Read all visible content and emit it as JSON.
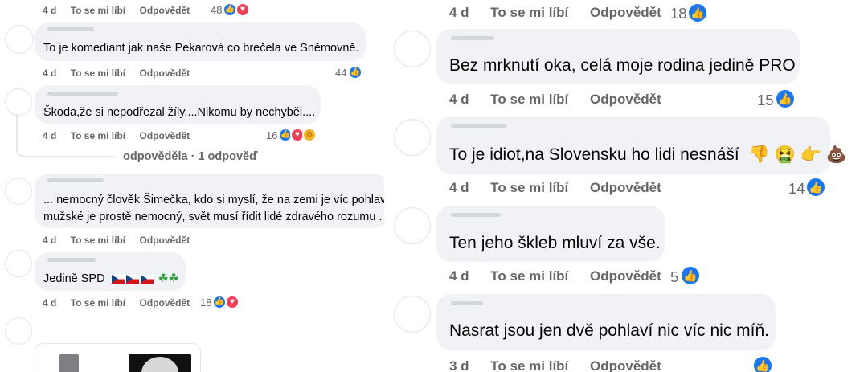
{
  "left": {
    "top_meta": {
      "time": "4 d",
      "like": "To se mi líbí",
      "reply": "Odpovědět",
      "count": "48"
    },
    "comments": [
      {
        "text": "To je komediant jak naše Pekarová co brečela ve Sněmovně.",
        "time": "4 d",
        "like": "To se mi líbí",
        "reply": "Odpovědět",
        "count": "44"
      },
      {
        "text": "Škoda,že si nepodřezal žíly....Nikomu by nechyběl....",
        "time": "4 d",
        "like": "To se mi líbí",
        "reply": "Odpovědět",
        "count": "16"
      },
      {
        "text_line1": "... nemocný člověk Šimečka, kdo si myslí, že na zemi je víc pohlaví",
        "text_line2": "mužské je prostě nemocný, svět musí řídit lidé zdravého rozumu .",
        "time": "4 d",
        "like": "To se mi líbí",
        "reply": "Odpovědět"
      },
      {
        "text": "Jedině SPD",
        "time": "4 d",
        "like": "To se mi líbí",
        "reply": "Odpovědět",
        "count": "18"
      }
    ],
    "replies_label": "odpověděla · 1 odpověď"
  },
  "right": {
    "top_meta": {
      "time": "4 d",
      "like": "To se mi líbí",
      "reply": "Odpovědět",
      "count": "18"
    },
    "comments": [
      {
        "text": "Bez mrknutí oka, celá moje rodina jedině PRO",
        "time": "4 d",
        "like": "To se mi líbí",
        "reply": "Odpovědět",
        "count": "15"
      },
      {
        "text": "To je idiot,na Slovensku ho lidi nesnáší",
        "time": "4 d",
        "like": "To se mi líbí",
        "reply": "Odpovědět",
        "count": "14"
      },
      {
        "text": "Ten jeho škleb mluví za vše.",
        "time": "4 d",
        "like": "To se mi líbí",
        "reply": "Odpovědět",
        "count": "5"
      },
      {
        "text": "Nasrat jsou jen dvě pohlaví nic víc nic míň.",
        "time": "3 d",
        "like": "To se mi líbí",
        "reply": "Odpovědět"
      }
    ]
  },
  "icons": {
    "like": "like-icon",
    "love": "love-icon",
    "haha": "haha-icon"
  },
  "colors": {
    "bubble": "#f0f2f5",
    "meta": "#65676b",
    "like": "#1877f2",
    "love": "#f33e58"
  }
}
